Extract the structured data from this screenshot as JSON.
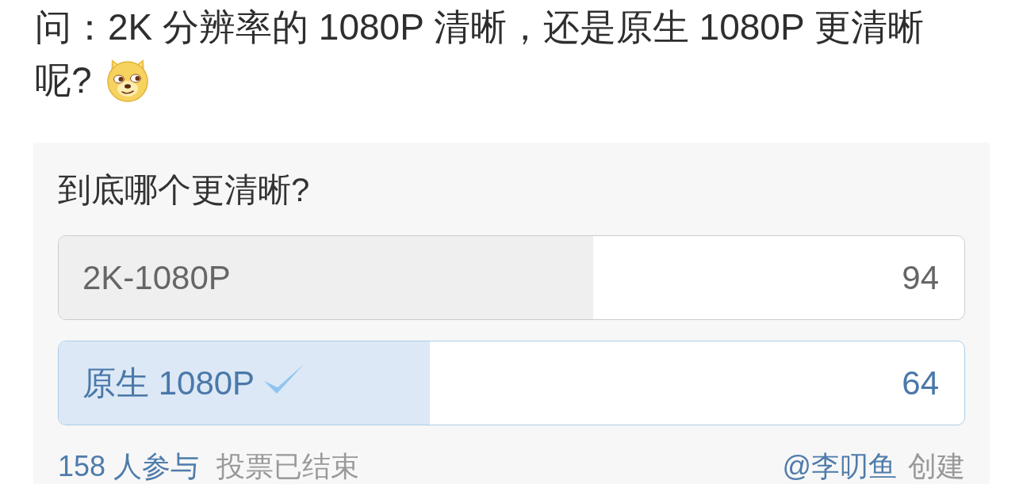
{
  "question": {
    "lines": [
      "问：2K 分辨率的 1080P 清晰，还是原生 1080P 更清晰",
      "呢?"
    ]
  },
  "poll": {
    "title": "到底哪个更清晰?",
    "options": [
      {
        "label": "2K-1080P",
        "count": "94",
        "level": 0.59,
        "selected": false
      },
      {
        "label": "原生 1080P",
        "count": "64",
        "level": 0.41,
        "selected": true
      }
    ],
    "footer": {
      "participants": "158 人参与",
      "status": "投票已结束",
      "creator": "@李叨鱼",
      "created": "创建"
    }
  }
}
